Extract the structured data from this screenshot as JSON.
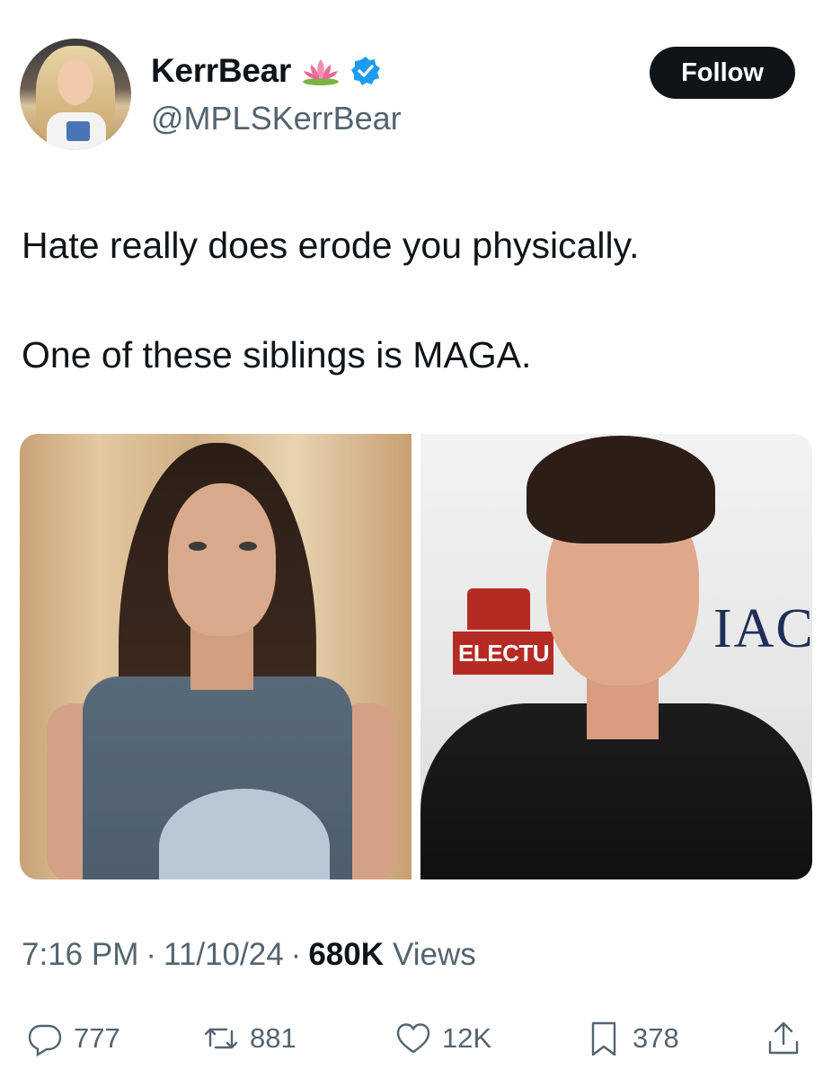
{
  "author": {
    "display_name": "KerrBear",
    "handle": "@MPLSKerrBear",
    "emoji_icon": "lotus-icon",
    "verified_icon": "verified-badge-icon",
    "verified_color": "#1d9bf0"
  },
  "follow_button": {
    "label": "Follow"
  },
  "tweet": {
    "line1": "Hate really does erode you physically.",
    "line2": "One of these siblings is MAGA."
  },
  "media": {
    "right_photo_sign_left": "ELECTU",
    "right_photo_sign_right": "IAC"
  },
  "meta": {
    "time": "7:16 PM",
    "separator": "·",
    "date": "11/10/24",
    "views_count": "680K",
    "views_label": "Views"
  },
  "actions": {
    "replies": "777",
    "reposts": "881",
    "likes": "12K",
    "bookmarks": "378"
  },
  "colors": {
    "text_primary": "#0f1419",
    "text_secondary": "#536471",
    "follow_bg": "#0f1419"
  }
}
